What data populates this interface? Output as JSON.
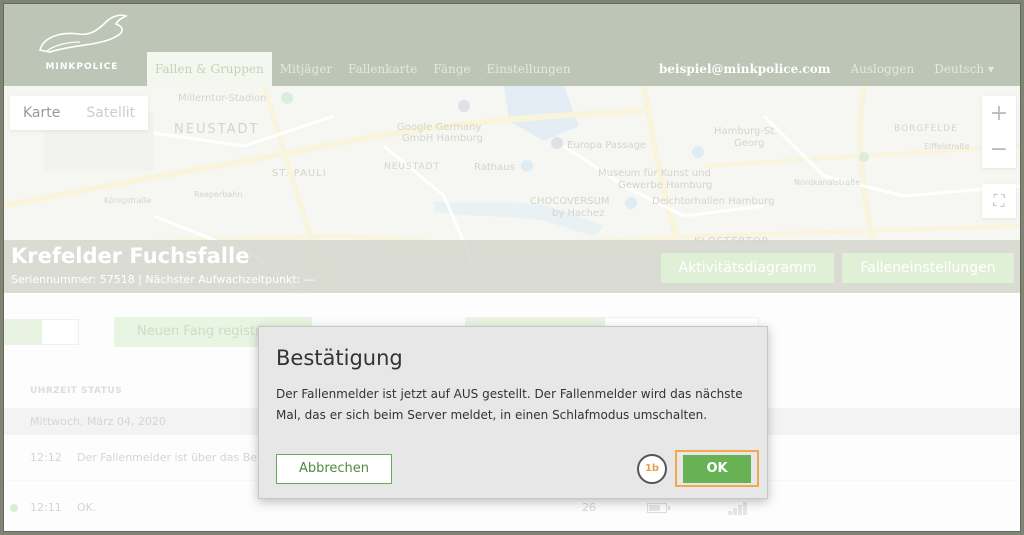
{
  "header": {
    "logo_text": "MINKPOLICE",
    "nav": [
      {
        "label": "Fallen & Gruppen",
        "active": true
      },
      {
        "label": "Mitjäger"
      },
      {
        "label": "Fallenkarte"
      },
      {
        "label": "Fänge"
      },
      {
        "label": "Einstellungen"
      }
    ],
    "user_email": "beispiel@minkpolice.com",
    "logout_label": "Ausloggen",
    "language_label": "Deutsch"
  },
  "map": {
    "type_buttons": {
      "map": "Karte",
      "satellite": "Satellit"
    },
    "zoom_in": "+",
    "zoom_out": "−",
    "labels": {
      "stadion": "Millerntor-Stadion",
      "neustadt_top": "NEUSTADT",
      "google": "Google Germany",
      "google2": "GmbH Hamburg",
      "europa": "Europa Passage",
      "hbf": "Hamburg-St.",
      "hbf2": "Georg",
      "borgfelde": "BORGFELDE",
      "eiffel": "Eiffelstraße",
      "stpauli": "ST. PAULI",
      "neustadt": "NEUSTADT",
      "rathaus": "Rathaus",
      "museum": "Museum für Kunst und",
      "museum2": "Gewerbe Hamburg",
      "reeperbahn": "Reeperbahn",
      "koenig": "Königstraße",
      "choco": "CHOCOVERSUM",
      "choco2": "by Hachez",
      "deich": "Deichtorhallen Hamburg",
      "nordkanal": "Nordkanalstraße",
      "kloster": "KLOSTERTOR"
    }
  },
  "trap": {
    "name": "Krefelder Fuchsfalle",
    "subtitle": "Seriennummer: 57518 | Nächster Aufwachzeitpunkt: —",
    "activity_button": "Aktivitätsdiagramm",
    "settings_button": "Falleneinstellungen"
  },
  "content": {
    "register_button": "Neuen Fang registri",
    "column_header": "UHRZEIT STATUS",
    "date_row": "Mittwoch, März 04, 2020",
    "rows": [
      {
        "time": "12:12",
        "text": "Der Fallenmelder ist über das Be"
      },
      {
        "time": "12:11",
        "text": "OK.",
        "num": "26",
        "battery_level": 0.6
      }
    ]
  },
  "modal": {
    "title": "Bestätigung",
    "body": "Der Fallenmelder ist jetzt auf AUS gestellt. Der Fallenmelder wird das nächste Mal, das er sich beim Server meldet, in einen Schlafmodus umschalten.",
    "cancel_label": "Abbrechen",
    "ok_label": "OK",
    "step_badge": "1b"
  },
  "colors": {
    "header_bg": "#7b8a6c",
    "accent_green": "#66b254",
    "highlight_orange": "#f0a94d"
  }
}
